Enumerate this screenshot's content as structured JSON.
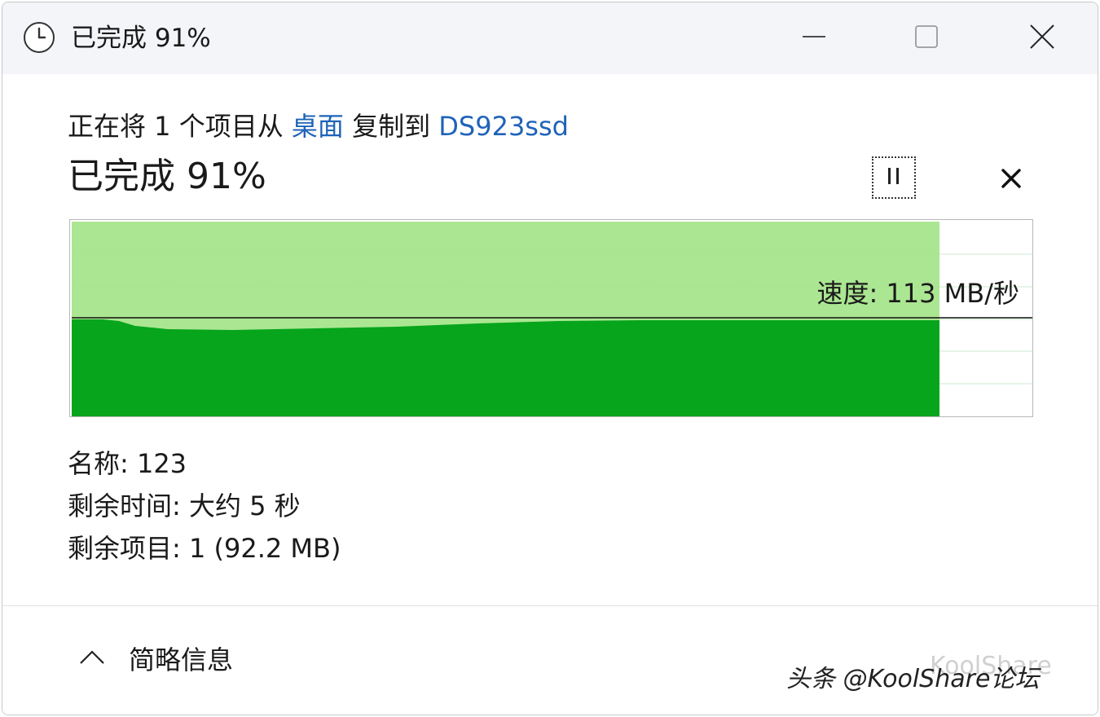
{
  "titlebar": {
    "title": "已完成 91%",
    "icon": "clock-icon",
    "minimize_icon": "minimize-icon",
    "maximize_icon": "maximize-icon",
    "close_icon": "close-icon"
  },
  "copy": {
    "prefix": "正在将 1 个项目从 ",
    "source": "桌面",
    "middle": " 复制到 ",
    "destination": "DS923ssd",
    "percent_label": "已完成 91%",
    "progress_fraction": 0.91
  },
  "controls": {
    "pause_icon": "pause-icon",
    "cancel_icon": "cancel-icon"
  },
  "graph": {
    "speed_label": "速度: 113 MB/秒",
    "colors": {
      "fill_light": "#a6e58c",
      "fill_dark": "#06a51c",
      "grid": "#cde8d2"
    }
  },
  "details": {
    "name_label": "名称: 123",
    "time_label": "剩余时间: 大约 5 秒",
    "items_label": "剩余项目: 1 (92.2 MB)"
  },
  "footer": {
    "chevron_icon": "chevron-up-icon",
    "summary_label": "简略信息",
    "watermark": "头条 @KoolShare论坛",
    "watermark_ghost": "KoolShare"
  }
}
